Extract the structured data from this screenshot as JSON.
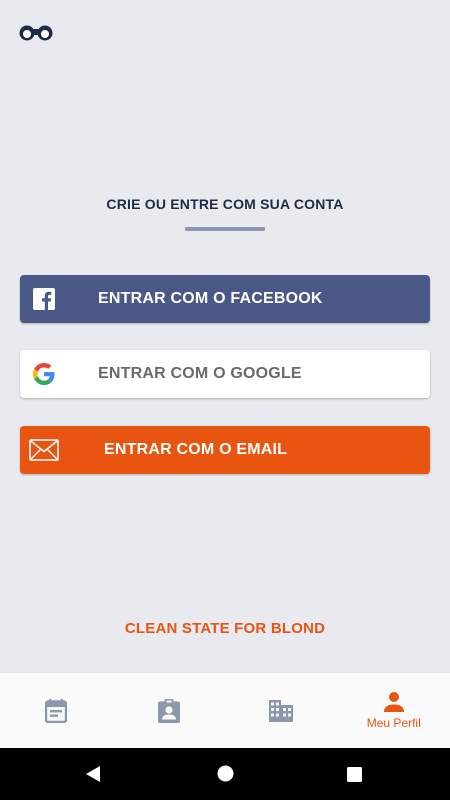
{
  "header": {
    "logo_icon": "binoculars-logo-icon"
  },
  "auth": {
    "heading": "CRIE OU ENTRE COM SUA CONTA",
    "facebook_label": "ENTRAR COM O FACEBOOK",
    "google_label": "ENTRAR COM O GOOGLE",
    "email_label": "ENTRAR COM O EMAIL",
    "clean_state_label": "CLEAN STATE FOR BLOND"
  },
  "colors": {
    "background": "#e9eaf0",
    "facebook": "#4a5888",
    "accent": "#e85510",
    "heading": "#1f2a44",
    "nav_inactive": "#8e96ad"
  },
  "bottom_nav": {
    "items": [
      {
        "icon": "calendar-icon",
        "label": ""
      },
      {
        "icon": "clipboard-user-icon",
        "label": ""
      },
      {
        "icon": "building-icon",
        "label": ""
      },
      {
        "icon": "person-icon",
        "label": "Meu Perfil",
        "active": true
      }
    ]
  },
  "system_nav": {
    "icons": [
      "back-icon",
      "home-icon",
      "recent-apps-icon"
    ]
  }
}
